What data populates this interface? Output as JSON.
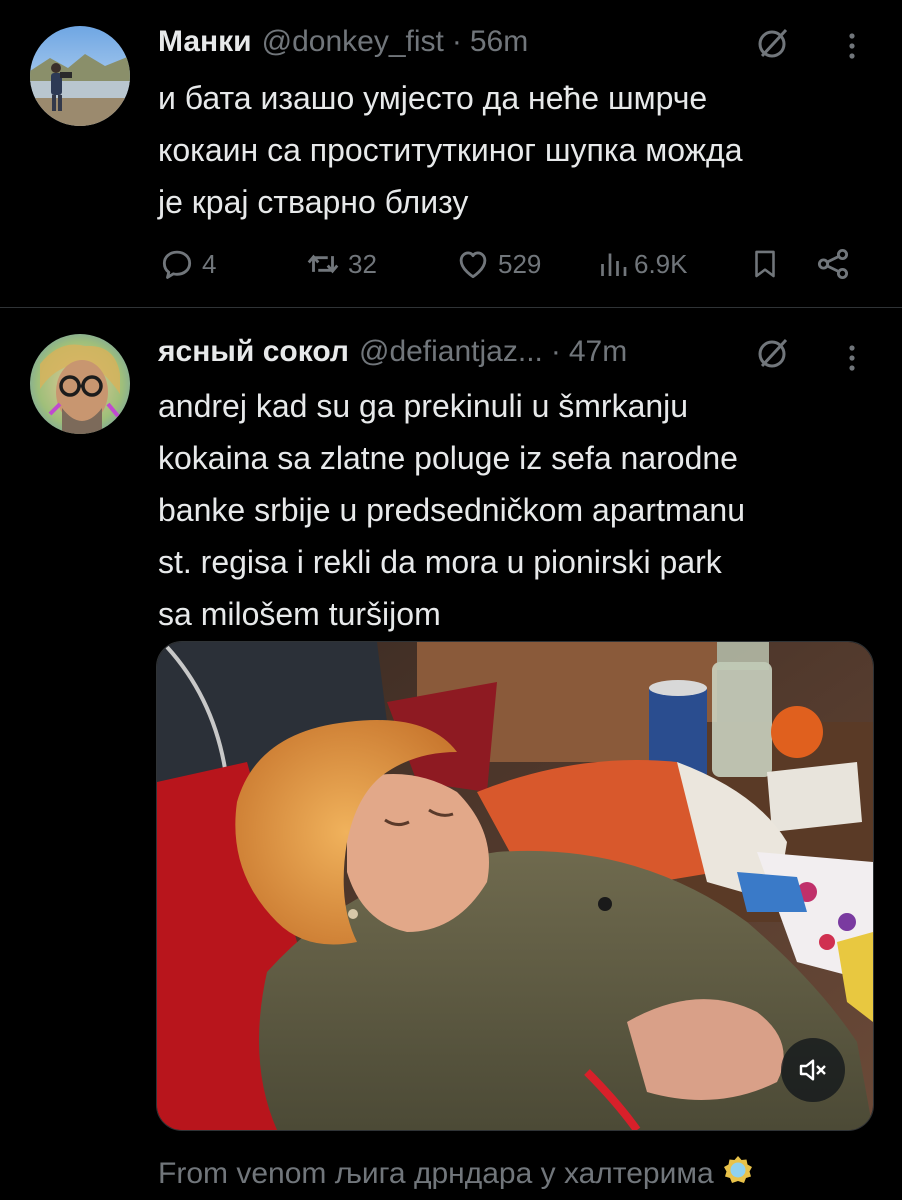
{
  "tweets": [
    {
      "author_name": "Манки",
      "handle": "@donkey_fist",
      "separator": "·",
      "time": "56m",
      "text_lines": [
        "и бата изашо умјесто да неће шмрче",
        "кокаин са проституткиног шупка можда",
        "је крај стварно близу"
      ],
      "actions": {
        "replies": "4",
        "retweets": "32",
        "likes": "529",
        "views": "6.9K"
      },
      "icons": [
        "reply-icon",
        "retweet-icon",
        "like-icon",
        "views-icon",
        "bookmark-icon",
        "share-icon",
        "muted-icon",
        "more-icon"
      ]
    },
    {
      "author_name": "ясный сокол",
      "handle": "@defiantjaz...",
      "separator": "·",
      "time": "47m",
      "text_lines": [
        "andrej kad su ga prekinuli u šmrkanju",
        "kokaina sa zlatne poluge iz sefa narodne",
        "banke srbije u predsedničkom apartmanu",
        "st. regisa i rekli da mora u pionirski park",
        "sa milošem turšijom"
      ],
      "media": {
        "type": "video",
        "muted": true,
        "icons": [
          "volume-muted-icon"
        ]
      },
      "footer_text": "From venom љига дрндара у халтерима"
    }
  ],
  "colors": {
    "background": "#000000",
    "text_primary": "#e7e9ea",
    "text_secondary": "#71767b",
    "divider": "#2f3336"
  }
}
